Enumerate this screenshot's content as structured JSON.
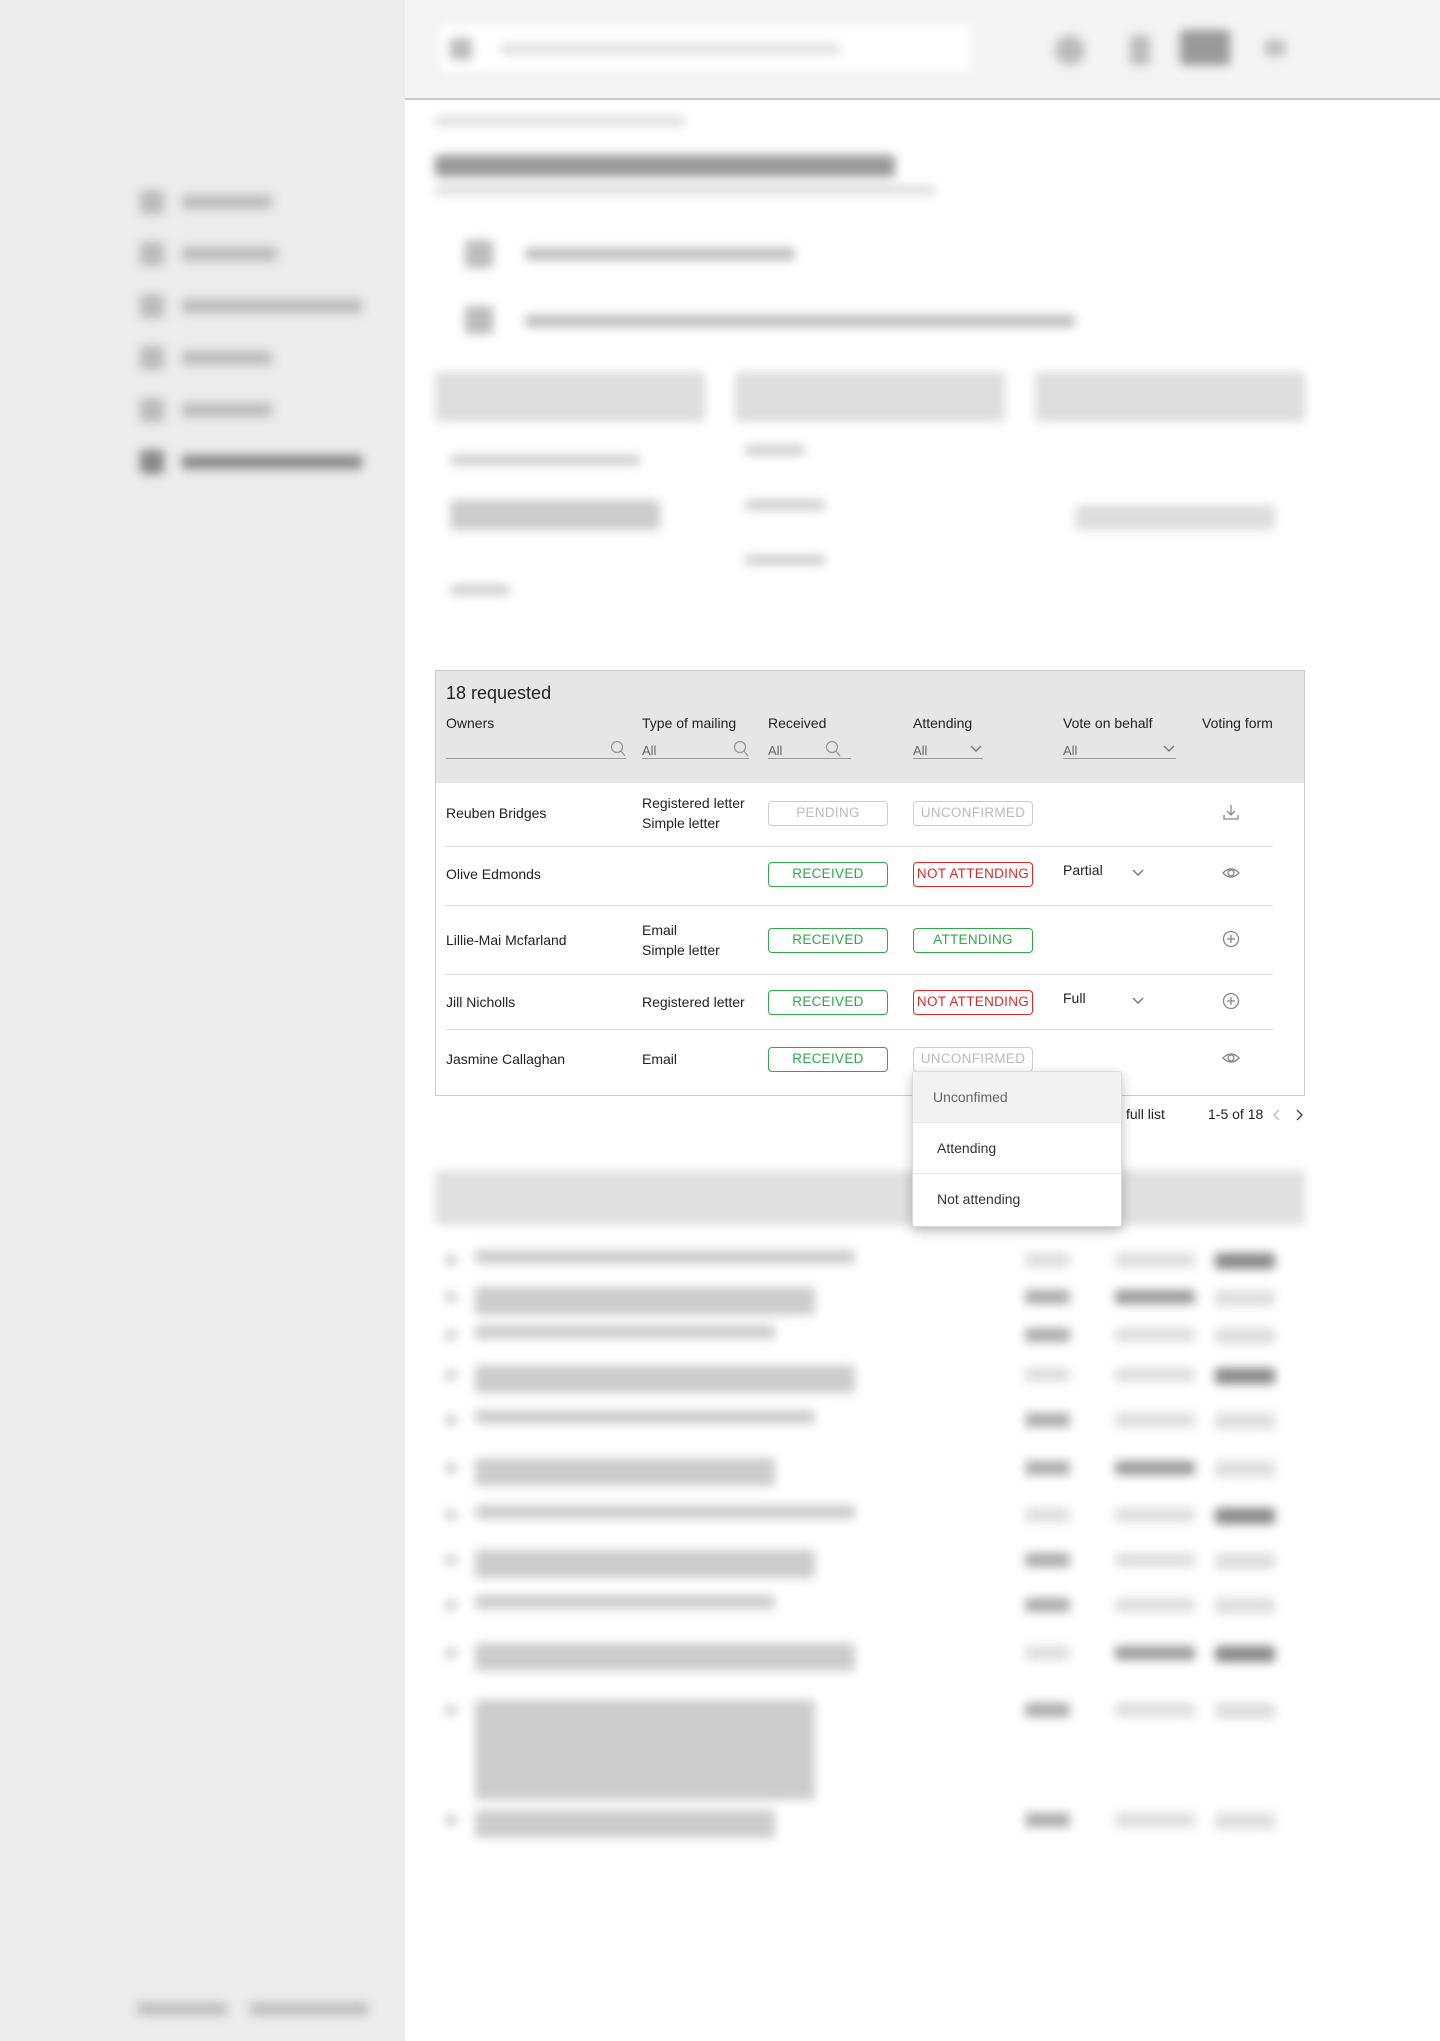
{
  "table": {
    "title": "18 requested",
    "columns": [
      "Owners",
      "Type of mailing",
      "Received",
      "Attending",
      "Vote on behalf",
      "Voting form"
    ],
    "filters": {
      "owners": "",
      "type": "All",
      "received": "All",
      "attending": "All",
      "vote": "All"
    },
    "rows": [
      {
        "owner": "Reuben Bridges",
        "mailing": [
          "Registered letter",
          "Simple letter"
        ],
        "received": "PENDING",
        "attending": "UNCONFIRMED",
        "vote": "",
        "form_icon": "download-icon"
      },
      {
        "owner": "Olive Edmonds",
        "mailing": [],
        "received": "RECEIVED",
        "attending": "NOT ATTENDING",
        "vote": "Partial",
        "form_icon": "eye-icon"
      },
      {
        "owner": "Lillie-Mai Mcfarland",
        "mailing": [
          "Email",
          "Simple letter"
        ],
        "received": "RECEIVED",
        "attending": "ATTENDING",
        "vote": "",
        "form_icon": "plus-circle-icon"
      },
      {
        "owner": "Jill Nicholls",
        "mailing": [
          "Registered letter"
        ],
        "received": "RECEIVED",
        "attending": "NOT ATTENDING",
        "vote": "Full",
        "form_icon": "plus-circle-icon"
      },
      {
        "owner": "Jasmine Callaghan",
        "mailing": [
          "Email"
        ],
        "received": "RECEIVED",
        "attending": "UNCONFIRMED",
        "vote": "",
        "form_icon": "eye-icon"
      }
    ]
  },
  "dropdown": {
    "options": [
      "Unconfimed",
      "Attending",
      "Not attending"
    ],
    "selected": "Unconfimed"
  },
  "pager": {
    "view_full": "w full list",
    "range": "1-5 of 18"
  },
  "colors": {
    "green": "#2eaa4a",
    "red": "#e02828",
    "pending": "#bbbbbb"
  }
}
